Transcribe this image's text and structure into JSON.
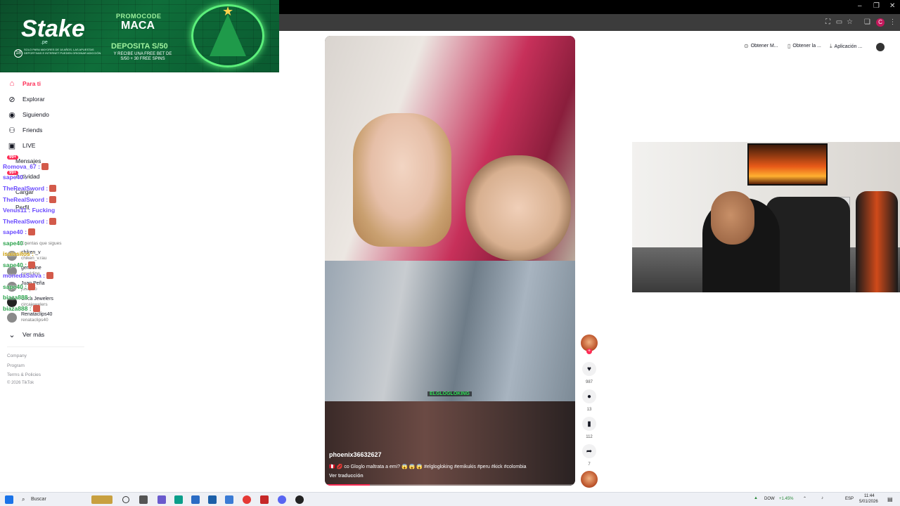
{
  "window": {
    "minimize": "–",
    "maximize": "❐",
    "close": "✕"
  },
  "browser": {
    "profile_initial": "C"
  },
  "banner": {
    "logo": "Stake",
    "logo_sub": ".pe",
    "age": "18",
    "legal": "SOLO PARA MAYORES DE 18 AÑOS. LAS APUESTAS DEPORTIVAS E INTERNET PUEDEN ORIGINAR ADICCIÓN",
    "promo_label": "PROMOCODE",
    "promo_code": "MACA",
    "deposit": "DEPOSITA S/50",
    "offer": "Y RECIBE UNA FREE BET DE S/50 + 30 FREE SPINS"
  },
  "sidebar": {
    "nav": [
      {
        "label": "Para ti",
        "icon": "home-icon"
      },
      {
        "label": "Explorar",
        "icon": "compass-icon"
      },
      {
        "label": "Siguiendo",
        "icon": "following-icon"
      },
      {
        "label": "Friends",
        "icon": "friends-icon"
      },
      {
        "label": "LIVE",
        "icon": "live-icon"
      },
      {
        "label": "Mensajes",
        "icon": "messages-icon"
      },
      {
        "label": "Actividad",
        "icon": "activity-icon"
      },
      {
        "label": "Cargar",
        "icon": "upload-icon"
      },
      {
        "label": "Perfil",
        "icon": "profile-icon"
      }
    ],
    "following_title": "Cuentas que sigues",
    "following": [
      {
        "name": "chiken_v",
        "handle": "chiken_v.rau"
      },
      {
        "name": "geraldine",
        "handle": "geraldine"
      },
      {
        "name": "Juan Peña",
        "handle": "jusapeo"
      },
      {
        "name": "Circa Jewelers",
        "handle": "circajewelers"
      },
      {
        "name": "Renataclips40",
        "handle": "renataclips40"
      }
    ],
    "see_more": "Ver más",
    "footer": [
      "Company",
      "Program",
      "Terms & Policies",
      "© 2026 TikTok"
    ]
  },
  "chat": [
    {
      "name": "Romova_67 :",
      "color": "p"
    },
    {
      "name": "sape40 :",
      "color": "p"
    },
    {
      "name": "TheRealSword :",
      "color": "p"
    },
    {
      "name": "TheRealSword :",
      "color": "p"
    },
    {
      "name": "Venus11 : Fucking",
      "color": "p"
    },
    {
      "name": "TheRealSword :",
      "color": "p"
    },
    {
      "name": "sape40 :",
      "color": "p"
    },
    {
      "name": "sape40 :",
      "color": "g"
    },
    {
      "name": "isaiasitos :",
      "color": "y"
    },
    {
      "name": "sape40 :",
      "color": "g"
    },
    {
      "name": "monedaSalva :",
      "color": "p"
    },
    {
      "name": "sape40 :",
      "color": "g"
    },
    {
      "name": "biaza888 :",
      "color": "g"
    },
    {
      "name": "biaza888 :",
      "color": "g"
    }
  ],
  "video": {
    "overlay_tag": "ELGLOGLOKING",
    "username": "phoenix36632627",
    "description": "🇵🇪 💋 co Gloglo maltrata a emi? 😱 😱 😱 #elglogloking #emikukis #peru #kick #colombia",
    "translate": "Ver traducción",
    "progress": 0.18
  },
  "actions": {
    "like_count": "987",
    "comment_count": "13",
    "save_count": "112",
    "share_count": "7",
    "follow_plus": "+"
  },
  "top_buttons": [
    {
      "label": "Obtener M...",
      "icon": "coin-icon"
    },
    {
      "label": "Obtener la ...",
      "icon": "phone-icon"
    },
    {
      "label": "Aplicación ...",
      "icon": "download-icon"
    }
  ],
  "taskbar": {
    "search": "Buscar",
    "ticker": "DOW",
    "ticker_change": "+1.45%",
    "lang": "ESP",
    "time": "11:44",
    "date": "5/01/2026"
  }
}
